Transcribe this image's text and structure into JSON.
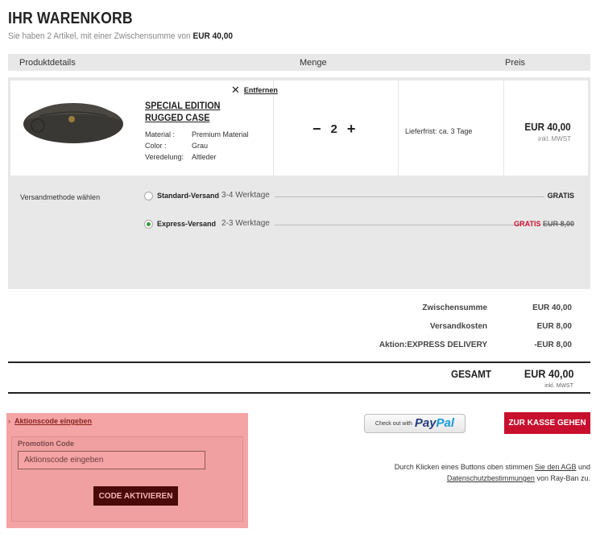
{
  "header": {
    "title": "IHR WARENKORB",
    "subtitle_prefix": "Sie haben 2 Artikel, mit einer Zwischensumme von",
    "subtitle_amount": "EUR 40,00"
  },
  "table_head": {
    "product": "Produktdetails",
    "quantity": "Menge",
    "price": "Preis"
  },
  "item": {
    "remove_label": "Entfernen",
    "name": "SPECIAL EDITION RUGGED CASE",
    "attributes": [
      {
        "key": "Material :",
        "value": "Premium Material"
      },
      {
        "key": "Color :",
        "value": "Grau"
      },
      {
        "key": "Veredelung:",
        "value": "Altleder"
      }
    ],
    "quantity": "2",
    "delivery": "Lieferfrist: ca. 3 Tage",
    "price": "EUR 40,00",
    "price_note": "inkl. MWST"
  },
  "shipping": {
    "label": "Versandmethode wählen",
    "options": [
      {
        "name": "Standard-Versand",
        "days": "3-4 Werktage",
        "price": "GRATIS",
        "old_price": "",
        "selected": false
      },
      {
        "name": "Express-Versand",
        "days": "2-3 Werktage",
        "price": "GRATIS",
        "old_price": "EUR 8,00",
        "selected": true
      }
    ]
  },
  "summary": {
    "subtotal_label": "Zwischensumme",
    "subtotal_value": "EUR 40,00",
    "shipping_label": "Versandkosten",
    "shipping_value": "EUR 8,00",
    "promo_label": "Aktion:EXPRESS DELIVERY",
    "promo_value": "-EUR 8,00",
    "total_label": "GESAMT",
    "total_value": "EUR 40,00",
    "total_note": "inkl. MWST"
  },
  "promo": {
    "toggle_label": "Aktionscode eingeben",
    "field_label": "Promotion Code",
    "placeholder": "Aktionscode eingeben",
    "button_label": "CODE AKTIVIEREN"
  },
  "checkout": {
    "paypal_prefix": "Check out with",
    "paypal_brand_1": "Pay",
    "paypal_brand_2": "Pal",
    "button_label": "ZUR KASSE GEHEN"
  },
  "legal": {
    "text_1": "Durch Klicken eines Buttons oben stimmen",
    "link_agb": "Sie den AGB",
    "text_2": "und",
    "link_privacy": "Datenschutzbestimmungen",
    "text_3": "von Ray-Ban zu."
  },
  "colors": {
    "accent": "#c8102e",
    "selected_radio": "#3a9a3a",
    "promo_highlight": "#f4a4a4"
  }
}
